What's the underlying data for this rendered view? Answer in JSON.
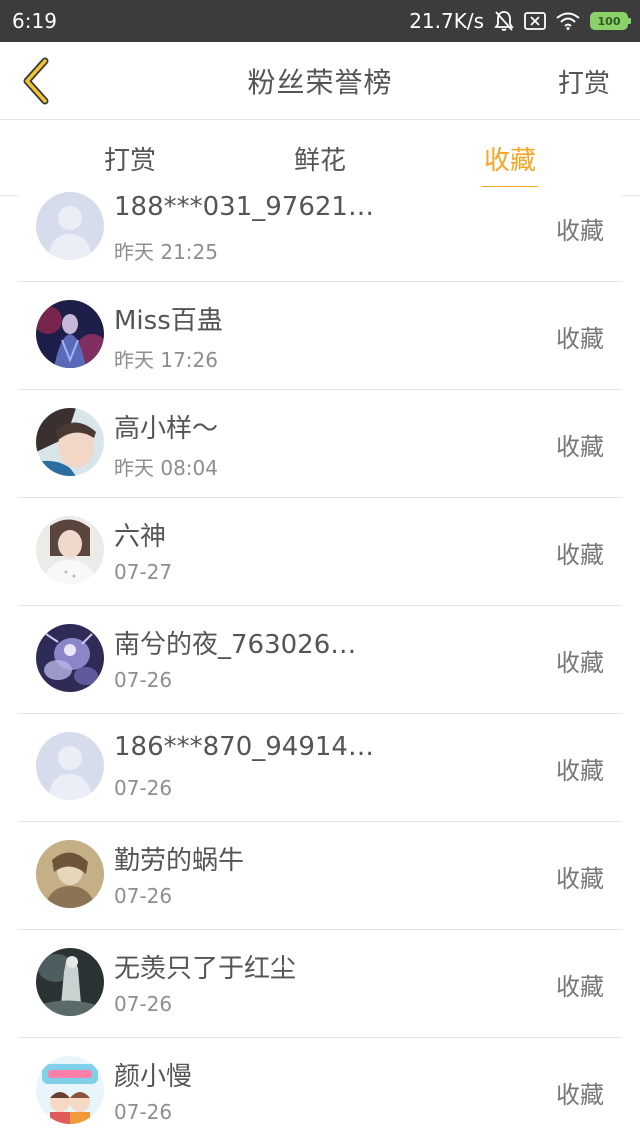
{
  "status_bar": {
    "time": "6:19",
    "net_speed": "21.7K/s",
    "battery": "100",
    "icons": [
      "bell-off-icon",
      "sim-off-icon",
      "wifi-icon",
      "battery-icon"
    ]
  },
  "header": {
    "back_icon": "chevron-left-icon",
    "title": "粉丝荣誉榜",
    "action_label": "打赏"
  },
  "tabs": [
    {
      "label": "打赏",
      "active": false
    },
    {
      "label": "鲜花",
      "active": false
    },
    {
      "label": "收藏",
      "active": true
    }
  ],
  "colors": {
    "accent": "#f5a623",
    "status_bar_bg": "#3c3c3c",
    "text": "#555555",
    "subtext": "#8e8e8e",
    "divider": "#e4e4e4"
  },
  "fans": [
    {
      "name": "188***031_97621…",
      "time": "昨天 21:25",
      "action": "收藏",
      "avatar": "default-avatar"
    },
    {
      "name": "Miss百蛊",
      "time": "昨天 17:26",
      "action": "收藏",
      "avatar": "photo-avatar"
    },
    {
      "name": "高小样～",
      "time": "昨天 08:04",
      "action": "收藏",
      "avatar": "photo-avatar"
    },
    {
      "name": "六神",
      "time": "07-27",
      "action": "收藏",
      "avatar": "photo-avatar"
    },
    {
      "name": "南兮的夜_763026…",
      "time": "07-26",
      "action": "收藏",
      "avatar": "photo-avatar"
    },
    {
      "name": "186***870_94914…",
      "time": "07-26",
      "action": "收藏",
      "avatar": "default-avatar"
    },
    {
      "name": "勤劳的蜗牛",
      "time": "07-26",
      "action": "收藏",
      "avatar": "photo-avatar"
    },
    {
      "name": "无羡只了于红尘",
      "time": "07-26",
      "action": "收藏",
      "avatar": "photo-avatar"
    },
    {
      "name": "颜小慢",
      "time": "07-26",
      "action": "收藏",
      "avatar": "photo-avatar"
    }
  ]
}
